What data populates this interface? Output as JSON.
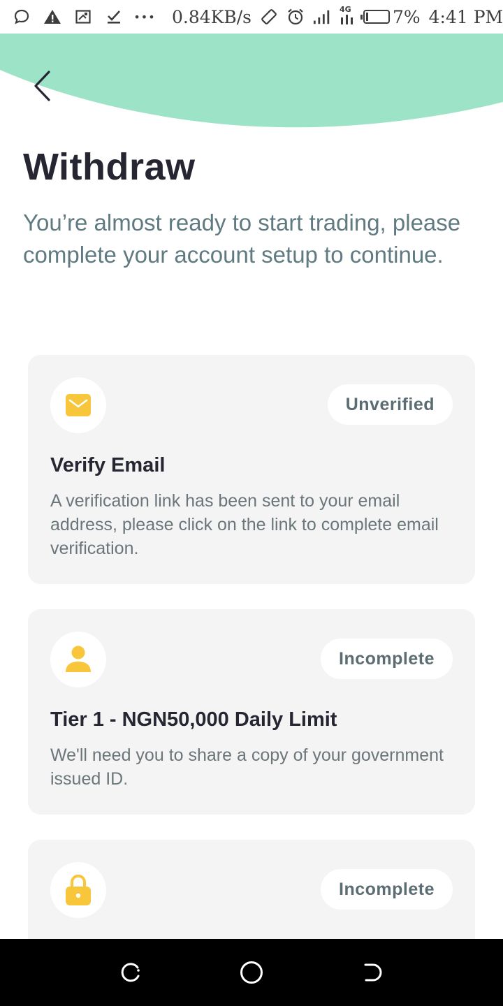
{
  "status_bar": {
    "speed": "0.84KB/s",
    "network": "4G",
    "battery": "7%",
    "time": "4:41 PM",
    "left_icons": [
      "chat-bubble-icon",
      "warning-icon",
      "screenshot-icon",
      "download-done-icon",
      "more-dots-icon"
    ],
    "more": "•••"
  },
  "colors": {
    "accent_mint": "#9de3c8",
    "icon_yellow": "#f8c63a",
    "card_bg": "#f4f4f4",
    "title": "#262633",
    "subtitle": "#5f7a80"
  },
  "header": {
    "title": "Withdraw",
    "subtitle": "You’re almost ready to start trading, please complete your account setup to continue."
  },
  "cards": [
    {
      "icon": "envelope-icon",
      "status": "Unverified",
      "title": "Verify Email",
      "description": "A verification link has been sent to your email address, please click on the link to complete email verification."
    },
    {
      "icon": "user-icon",
      "status": "Incomplete",
      "title": "Tier 1 - NGN50,000 Daily Limit",
      "description": "We'll need you to share a copy of your government issued ID."
    },
    {
      "icon": "lock-icon",
      "status": "Incomplete",
      "title": "",
      "description": ""
    }
  ],
  "nav_bar": {
    "buttons": [
      "recents-icon",
      "home-icon",
      "back-nav-icon"
    ]
  }
}
